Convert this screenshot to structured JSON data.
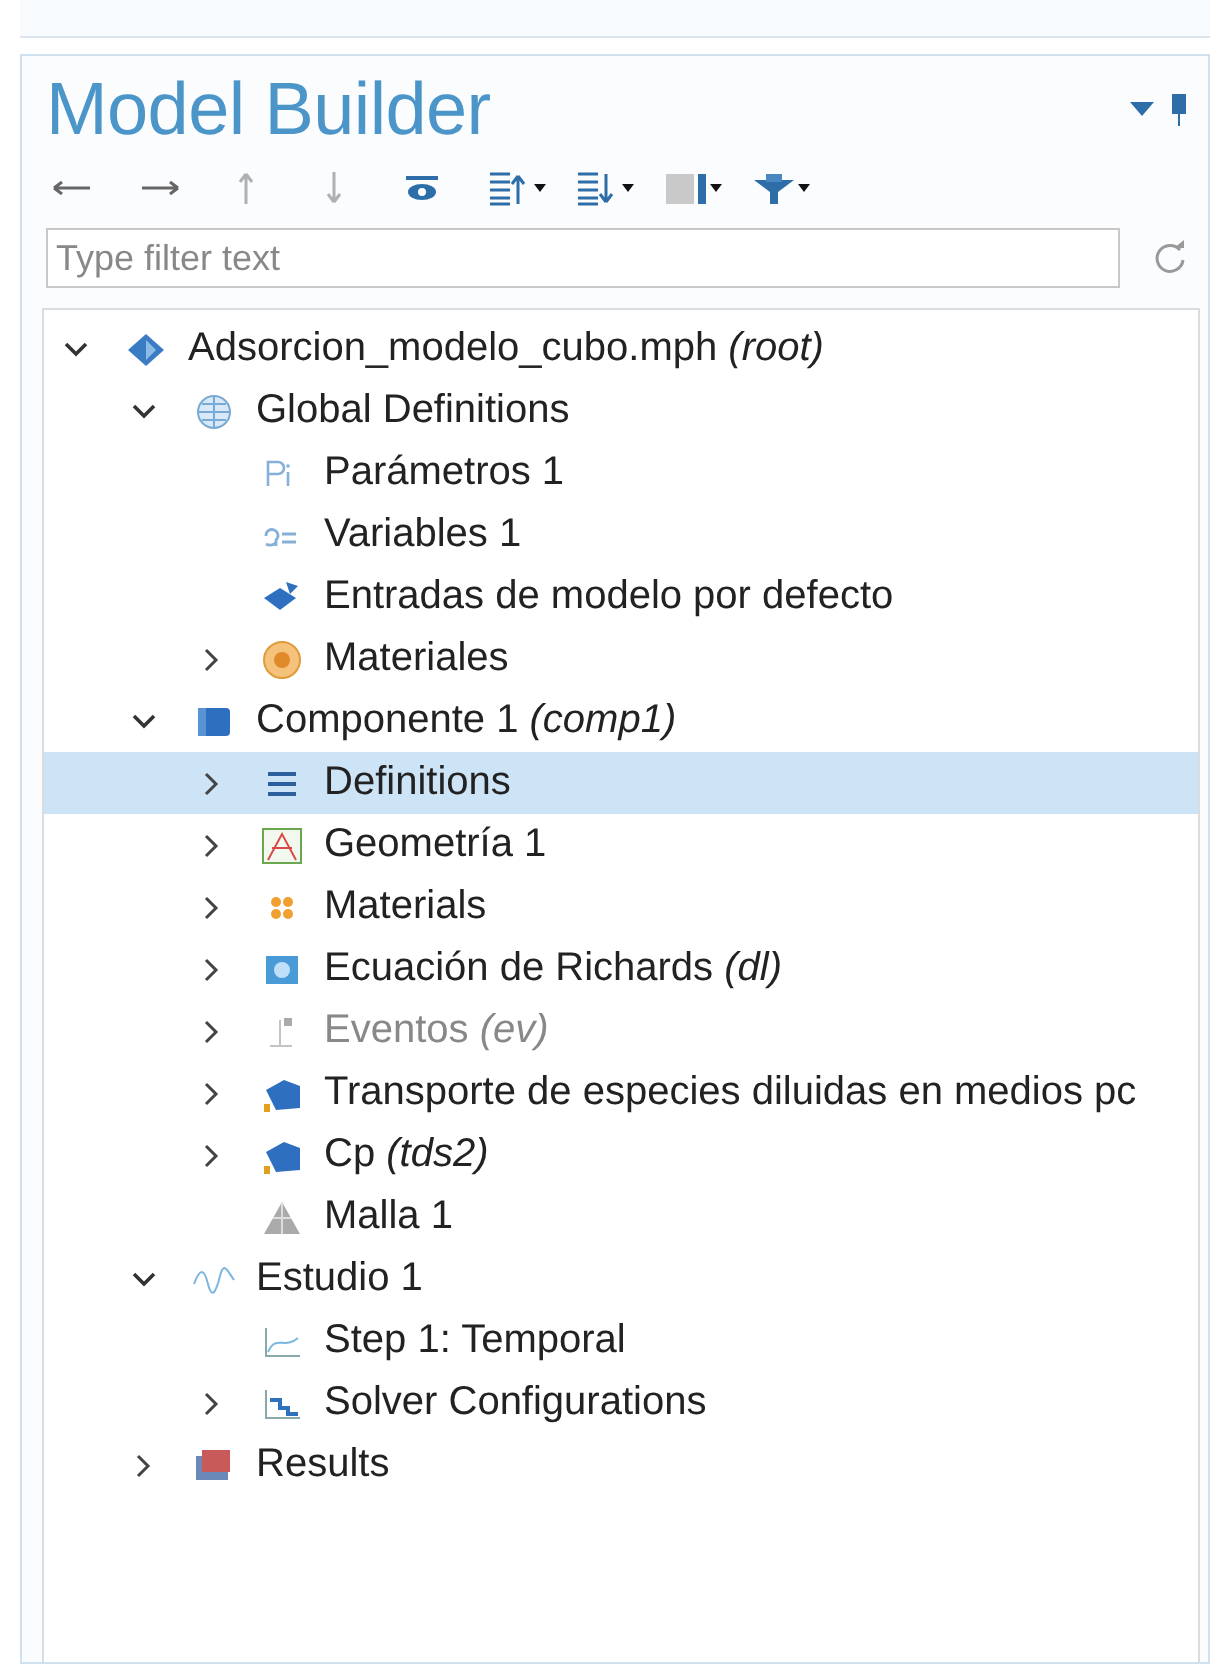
{
  "panel": {
    "title": "Model Builder"
  },
  "toolbar": [
    {
      "kind": "back",
      "disabled": false
    },
    {
      "kind": "forward",
      "disabled": false
    },
    {
      "kind": "up",
      "disabled": true
    },
    {
      "kind": "down",
      "disabled": true
    },
    {
      "kind": "show",
      "disabled": false
    },
    {
      "kind": "expand",
      "disabled": false
    },
    {
      "kind": "collapse",
      "disabled": false
    },
    {
      "kind": "columns",
      "disabled": false
    },
    {
      "kind": "filter",
      "disabled": false
    }
  ],
  "filter": {
    "placeholder": "Type filter text"
  },
  "tree": [
    {
      "label": "Adsorcion_modelo_cubo.mph *(root)*",
      "kind": "model",
      "expanded": true,
      "selected": false,
      "disabled": false,
      "children": [
        {
          "label": "Global Definitions",
          "kind": "globe",
          "expanded": true,
          "selected": false,
          "disabled": false,
          "children": [
            {
              "label": "Parámetros 1",
              "kind": "params",
              "selected": false,
              "disabled": false
            },
            {
              "label": "Variables 1",
              "kind": "vars",
              "selected": false,
              "disabled": false
            },
            {
              "label": "Entradas de modelo por defecto",
              "kind": "inputs",
              "selected": false,
              "disabled": false
            },
            {
              "label": "Materiales",
              "kind": "materials-global",
              "expanded": false,
              "selected": false,
              "disabled": false
            }
          ]
        },
        {
          "label": "Componente 1 *(comp1)*",
          "kind": "component",
          "expanded": true,
          "selected": false,
          "disabled": false,
          "children": [
            {
              "label": "Definitions",
              "kind": "definitions",
              "expanded": false,
              "selected": true,
              "disabled": false
            },
            {
              "label": "Geometría 1",
              "kind": "geometry",
              "expanded": false,
              "selected": false,
              "disabled": false
            },
            {
              "label": "Materials",
              "kind": "materials",
              "expanded": false,
              "selected": false,
              "disabled": false
            },
            {
              "label": "Ecuación de Richards *(dl)*",
              "kind": "physics",
              "expanded": false,
              "selected": false,
              "disabled": false
            },
            {
              "label": "Eventos *(ev)*",
              "kind": "events",
              "expanded": false,
              "selected": false,
              "disabled": true
            },
            {
              "label": "Transporte de especies diluidas en medios pc",
              "kind": "transport",
              "expanded": false,
              "selected": false,
              "disabled": false
            },
            {
              "label": "Cp *(tds2)*",
              "kind": "transport",
              "expanded": false,
              "selected": false,
              "disabled": false
            },
            {
              "label": "Malla 1",
              "kind": "mesh",
              "selected": false,
              "disabled": false
            }
          ]
        },
        {
          "label": "Estudio 1",
          "kind": "study",
          "expanded": true,
          "selected": false,
          "disabled": false,
          "children": [
            {
              "label": "Step 1: Temporal",
              "kind": "step",
              "selected": false,
              "disabled": false
            },
            {
              "label": "Solver Configurations",
              "kind": "solver",
              "expanded": false,
              "selected": false,
              "disabled": false
            }
          ]
        },
        {
          "label": "Results",
          "kind": "results",
          "expanded": false,
          "selected": false,
          "disabled": false
        }
      ]
    }
  ]
}
